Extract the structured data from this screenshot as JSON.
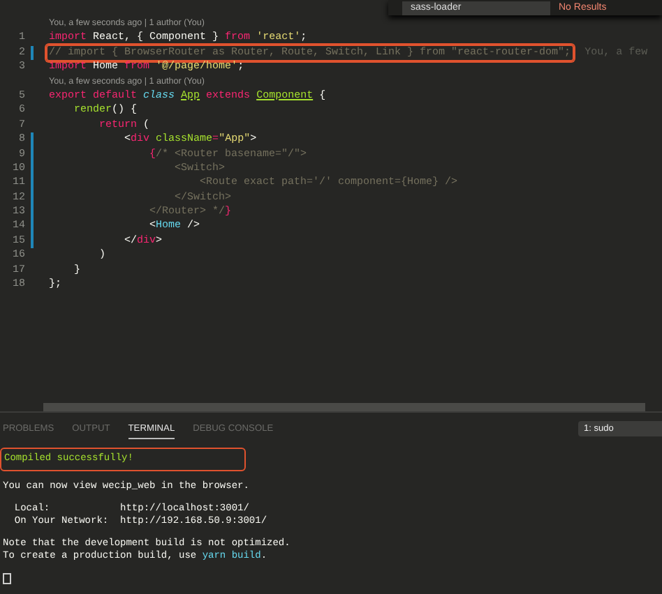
{
  "find_widget": {
    "value": "sass-loader",
    "result": "No Results"
  },
  "editor": {
    "lines": [
      {
        "kind": "codelens",
        "text": "You, a few seconds ago | 1 author (You)"
      },
      {
        "kind": "code",
        "number": "1",
        "modified": false,
        "highlighted": false,
        "tokens": [
          {
            "kind": "keyword",
            "text": "import"
          },
          {
            "kind": "plain",
            "text": " React, { Component } "
          },
          {
            "kind": "keyword",
            "text": "from"
          },
          {
            "kind": "string",
            "text": " 'react'"
          },
          {
            "kind": "plain",
            "text": ";"
          }
        ]
      },
      {
        "kind": "code",
        "number": "2",
        "modified": true,
        "highlighted": true,
        "tokens": [
          {
            "kind": "comment",
            "text": "// import { BrowserRouter as Router, Route, Switch, Link } from \"react-router-dom\";"
          }
        ],
        "blame": "You, a few"
      },
      {
        "kind": "code",
        "number": "3",
        "modified": false,
        "highlighted": false,
        "tokens": [
          {
            "kind": "keyword",
            "text": "import"
          },
          {
            "kind": "plain",
            "text": " Home "
          },
          {
            "kind": "keyword",
            "text": "from"
          },
          {
            "kind": "string",
            "text": " '@/page/home'"
          },
          {
            "kind": "plain",
            "text": ";"
          }
        ]
      },
      {
        "kind": "codelens",
        "text": "You, a few seconds ago | 1 author (You)"
      },
      {
        "kind": "code",
        "number": "5",
        "modified": false,
        "highlighted": false,
        "tokens": [
          {
            "kind": "keyword",
            "text": "export default"
          },
          {
            "kind": "storage",
            "text": " class "
          },
          {
            "kind": "class",
            "text": "App"
          },
          {
            "kind": "keyword",
            "text": " extends "
          },
          {
            "kind": "class",
            "text": "Component"
          },
          {
            "kind": "plain",
            "text": " {"
          }
        ]
      },
      {
        "kind": "code",
        "number": "6",
        "modified": false,
        "highlighted": false,
        "tokens": [
          {
            "kind": "function",
            "text": "    render"
          },
          {
            "kind": "plain",
            "text": "() {"
          }
        ]
      },
      {
        "kind": "code",
        "number": "7",
        "modified": false,
        "highlighted": false,
        "tokens": [
          {
            "kind": "keyword",
            "text": "        return"
          },
          {
            "kind": "plain",
            "text": " ("
          }
        ]
      },
      {
        "kind": "code",
        "number": "8",
        "modified": true,
        "highlighted": false,
        "tokens": [
          {
            "kind": "plain",
            "text": "            <"
          },
          {
            "kind": "tag",
            "text": "div"
          },
          {
            "kind": "attr",
            "text": " className"
          },
          {
            "kind": "keyword",
            "text": "="
          },
          {
            "kind": "string",
            "text": "\"App\""
          },
          {
            "kind": "plain",
            "text": ">"
          }
        ]
      },
      {
        "kind": "code",
        "number": "9",
        "modified": true,
        "highlighted": false,
        "tokens": [
          {
            "kind": "tag",
            "text": "                {"
          },
          {
            "kind": "comment",
            "text": "/* <Router basename=\"/\">"
          }
        ]
      },
      {
        "kind": "code",
        "number": "10",
        "modified": true,
        "highlighted": false,
        "tokens": [
          {
            "kind": "comment",
            "text": "                    <Switch>"
          }
        ]
      },
      {
        "kind": "code",
        "number": "11",
        "modified": true,
        "highlighted": false,
        "tokens": [
          {
            "kind": "comment",
            "text": "                        <Route exact path='/' component={Home} />"
          }
        ]
      },
      {
        "kind": "code",
        "number": "12",
        "modified": true,
        "highlighted": false,
        "tokens": [
          {
            "kind": "comment",
            "text": "                    </Switch>"
          }
        ]
      },
      {
        "kind": "code",
        "number": "13",
        "modified": true,
        "highlighted": false,
        "tokens": [
          {
            "kind": "comment",
            "text": "                </Router> */"
          },
          {
            "kind": "tag",
            "text": "}"
          }
        ]
      },
      {
        "kind": "code",
        "number": "14",
        "modified": true,
        "highlighted": false,
        "tokens": [
          {
            "kind": "plain",
            "text": "                <"
          },
          {
            "kind": "component",
            "text": "Home"
          },
          {
            "kind": "plain",
            "text": " />"
          }
        ]
      },
      {
        "kind": "code",
        "number": "15",
        "modified": true,
        "highlighted": false,
        "tokens": [
          {
            "kind": "plain",
            "text": "            </"
          },
          {
            "kind": "tag",
            "text": "div"
          },
          {
            "kind": "plain",
            "text": ">"
          }
        ]
      },
      {
        "kind": "code",
        "number": "16",
        "modified": false,
        "highlighted": false,
        "tokens": [
          {
            "kind": "plain",
            "text": "        )"
          }
        ]
      },
      {
        "kind": "code",
        "number": "17",
        "modified": false,
        "highlighted": false,
        "tokens": [
          {
            "kind": "plain",
            "text": "    }"
          }
        ]
      },
      {
        "kind": "code",
        "number": "18",
        "modified": false,
        "highlighted": false,
        "tokens": [
          {
            "kind": "plain",
            "text": "};"
          }
        ]
      }
    ]
  },
  "panel": {
    "tabs": [
      {
        "label": "PROBLEMS",
        "selected": false
      },
      {
        "label": "OUTPUT",
        "selected": false
      },
      {
        "label": "TERMINAL",
        "selected": true
      },
      {
        "label": "DEBUG CONSOLE",
        "selected": false
      }
    ],
    "terminal_selector": "1: sudo",
    "terminal": [
      {
        "kind": "text",
        "lines": [
          {
            "highlighted": true,
            "tokens": [
              {
                "kind": "success",
                "text": "Compiled successfully!"
              }
            ]
          }
        ]
      },
      {
        "kind": "text",
        "lines": [
          {
            "highlighted": false,
            "tokens": [
              {
                "kind": "plain",
                "text": "You can now view wecip_web in the browser."
              }
            ]
          }
        ]
      },
      {
        "kind": "text",
        "lines": [
          {
            "highlighted": false,
            "tokens": [
              {
                "kind": "plain",
                "text": "  Local:            http://localhost:3001/"
              }
            ]
          },
          {
            "highlighted": false,
            "tokens": [
              {
                "kind": "plain",
                "text": "  On Your Network:  http://192.168.50.9:3001/"
              }
            ]
          }
        ]
      },
      {
        "kind": "text",
        "lines": [
          {
            "highlighted": false,
            "tokens": [
              {
                "kind": "plain",
                "text": "Note that the development build is not optimized."
              }
            ]
          },
          {
            "highlighted": false,
            "tokens": [
              {
                "kind": "plain",
                "text": "To create a production build, use "
              },
              {
                "kind": "command",
                "text": "yarn build"
              },
              {
                "kind": "plain",
                "text": "."
              }
            ]
          }
        ]
      },
      {
        "kind": "cursor"
      }
    ]
  }
}
